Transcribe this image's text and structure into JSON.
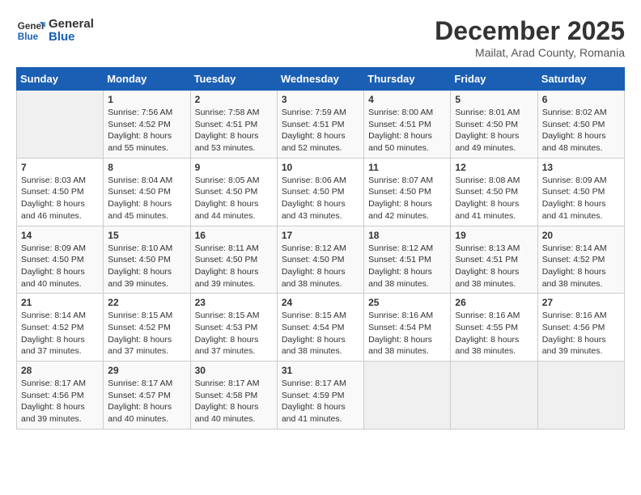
{
  "logo": {
    "line1": "General",
    "line2": "Blue"
  },
  "title": "December 2025",
  "location": "Mailat, Arad County, Romania",
  "weekdays": [
    "Sunday",
    "Monday",
    "Tuesday",
    "Wednesday",
    "Thursday",
    "Friday",
    "Saturday"
  ],
  "weeks": [
    [
      {
        "day": "",
        "empty": true
      },
      {
        "day": "1",
        "sunrise": "7:56 AM",
        "sunset": "4:52 PM",
        "daylight": "8 hours and 55 minutes."
      },
      {
        "day": "2",
        "sunrise": "7:58 AM",
        "sunset": "4:51 PM",
        "daylight": "8 hours and 53 minutes."
      },
      {
        "day": "3",
        "sunrise": "7:59 AM",
        "sunset": "4:51 PM",
        "daylight": "8 hours and 52 minutes."
      },
      {
        "day": "4",
        "sunrise": "8:00 AM",
        "sunset": "4:51 PM",
        "daylight": "8 hours and 50 minutes."
      },
      {
        "day": "5",
        "sunrise": "8:01 AM",
        "sunset": "4:50 PM",
        "daylight": "8 hours and 49 minutes."
      },
      {
        "day": "6",
        "sunrise": "8:02 AM",
        "sunset": "4:50 PM",
        "daylight": "8 hours and 48 minutes."
      }
    ],
    [
      {
        "day": "7",
        "sunrise": "8:03 AM",
        "sunset": "4:50 PM",
        "daylight": "8 hours and 46 minutes."
      },
      {
        "day": "8",
        "sunrise": "8:04 AM",
        "sunset": "4:50 PM",
        "daylight": "8 hours and 45 minutes."
      },
      {
        "day": "9",
        "sunrise": "8:05 AM",
        "sunset": "4:50 PM",
        "daylight": "8 hours and 44 minutes."
      },
      {
        "day": "10",
        "sunrise": "8:06 AM",
        "sunset": "4:50 PM",
        "daylight": "8 hours and 43 minutes."
      },
      {
        "day": "11",
        "sunrise": "8:07 AM",
        "sunset": "4:50 PM",
        "daylight": "8 hours and 42 minutes."
      },
      {
        "day": "12",
        "sunrise": "8:08 AM",
        "sunset": "4:50 PM",
        "daylight": "8 hours and 41 minutes."
      },
      {
        "day": "13",
        "sunrise": "8:09 AM",
        "sunset": "4:50 PM",
        "daylight": "8 hours and 41 minutes."
      }
    ],
    [
      {
        "day": "14",
        "sunrise": "8:09 AM",
        "sunset": "4:50 PM",
        "daylight": "8 hours and 40 minutes."
      },
      {
        "day": "15",
        "sunrise": "8:10 AM",
        "sunset": "4:50 PM",
        "daylight": "8 hours and 39 minutes."
      },
      {
        "day": "16",
        "sunrise": "8:11 AM",
        "sunset": "4:50 PM",
        "daylight": "8 hours and 39 minutes."
      },
      {
        "day": "17",
        "sunrise": "8:12 AM",
        "sunset": "4:50 PM",
        "daylight": "8 hours and 38 minutes."
      },
      {
        "day": "18",
        "sunrise": "8:12 AM",
        "sunset": "4:51 PM",
        "daylight": "8 hours and 38 minutes."
      },
      {
        "day": "19",
        "sunrise": "8:13 AM",
        "sunset": "4:51 PM",
        "daylight": "8 hours and 38 minutes."
      },
      {
        "day": "20",
        "sunrise": "8:14 AM",
        "sunset": "4:52 PM",
        "daylight": "8 hours and 38 minutes."
      }
    ],
    [
      {
        "day": "21",
        "sunrise": "8:14 AM",
        "sunset": "4:52 PM",
        "daylight": "8 hours and 37 minutes."
      },
      {
        "day": "22",
        "sunrise": "8:15 AM",
        "sunset": "4:52 PM",
        "daylight": "8 hours and 37 minutes."
      },
      {
        "day": "23",
        "sunrise": "8:15 AM",
        "sunset": "4:53 PM",
        "daylight": "8 hours and 37 minutes."
      },
      {
        "day": "24",
        "sunrise": "8:15 AM",
        "sunset": "4:54 PM",
        "daylight": "8 hours and 38 minutes."
      },
      {
        "day": "25",
        "sunrise": "8:16 AM",
        "sunset": "4:54 PM",
        "daylight": "8 hours and 38 minutes."
      },
      {
        "day": "26",
        "sunrise": "8:16 AM",
        "sunset": "4:55 PM",
        "daylight": "8 hours and 38 minutes."
      },
      {
        "day": "27",
        "sunrise": "8:16 AM",
        "sunset": "4:56 PM",
        "daylight": "8 hours and 39 minutes."
      }
    ],
    [
      {
        "day": "28",
        "sunrise": "8:17 AM",
        "sunset": "4:56 PM",
        "daylight": "8 hours and 39 minutes."
      },
      {
        "day": "29",
        "sunrise": "8:17 AM",
        "sunset": "4:57 PM",
        "daylight": "8 hours and 40 minutes."
      },
      {
        "day": "30",
        "sunrise": "8:17 AM",
        "sunset": "4:58 PM",
        "daylight": "8 hours and 40 minutes."
      },
      {
        "day": "31",
        "sunrise": "8:17 AM",
        "sunset": "4:59 PM",
        "daylight": "8 hours and 41 minutes."
      },
      {
        "day": "",
        "empty": true
      },
      {
        "day": "",
        "empty": true
      },
      {
        "day": "",
        "empty": true
      }
    ]
  ]
}
